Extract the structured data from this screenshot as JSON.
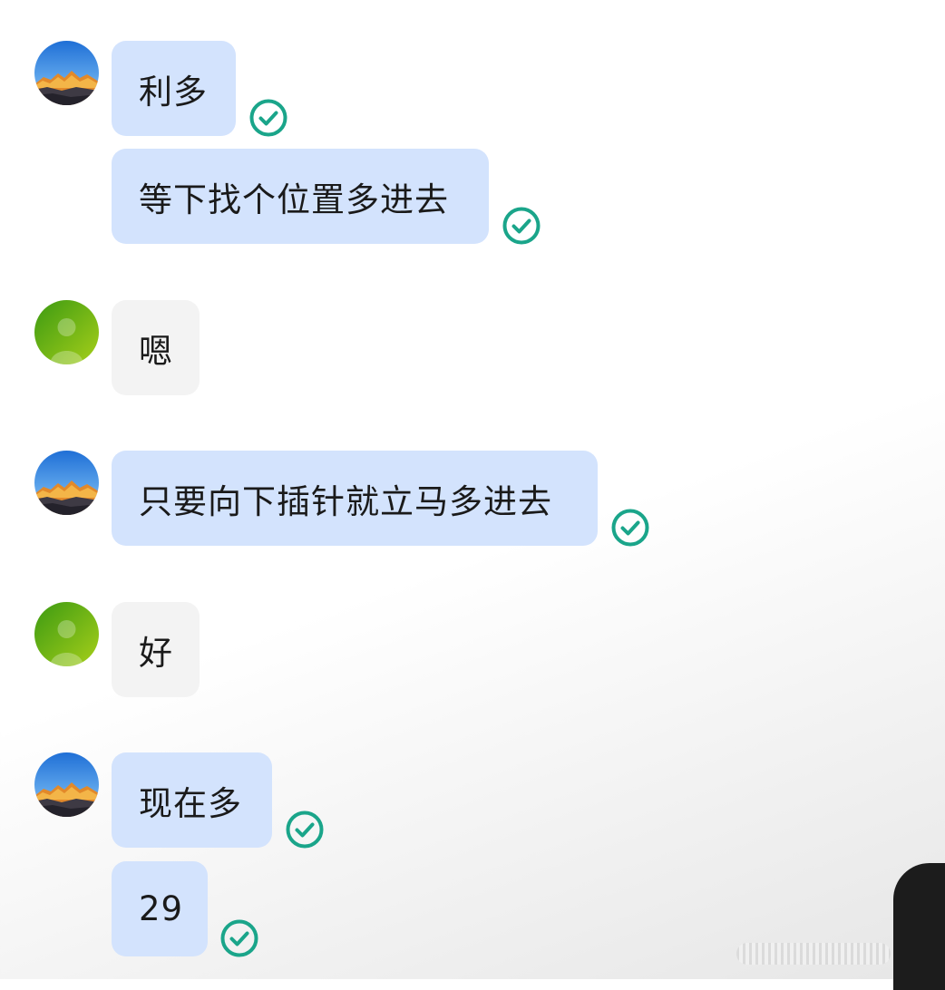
{
  "messages": [
    {
      "id": 1,
      "sender": "self",
      "text": "利多",
      "status": "read"
    },
    {
      "id": 2,
      "sender": "self",
      "text": "等下找个位置多进去",
      "status": "read"
    },
    {
      "id": 3,
      "sender": "other",
      "text": "嗯"
    },
    {
      "id": 4,
      "sender": "self",
      "text": "只要向下插针就立马多进去",
      "status": "read"
    },
    {
      "id": 5,
      "sender": "other",
      "text": "好"
    },
    {
      "id": 6,
      "sender": "self",
      "text": "现在多",
      "status": "read"
    },
    {
      "id": 7,
      "sender": "self",
      "text": "29",
      "status": "read"
    }
  ],
  "icons": {
    "self_avatar": "mountain-landscape-avatar",
    "other_avatar": "default-person-avatar",
    "read_status": "check-circle-icon"
  },
  "colors": {
    "sent_bubble": "#d3e3fd",
    "received_bubble": "#f3f3f3",
    "check_icon": "#1aa58a",
    "other_avatar": "#7cc023"
  }
}
